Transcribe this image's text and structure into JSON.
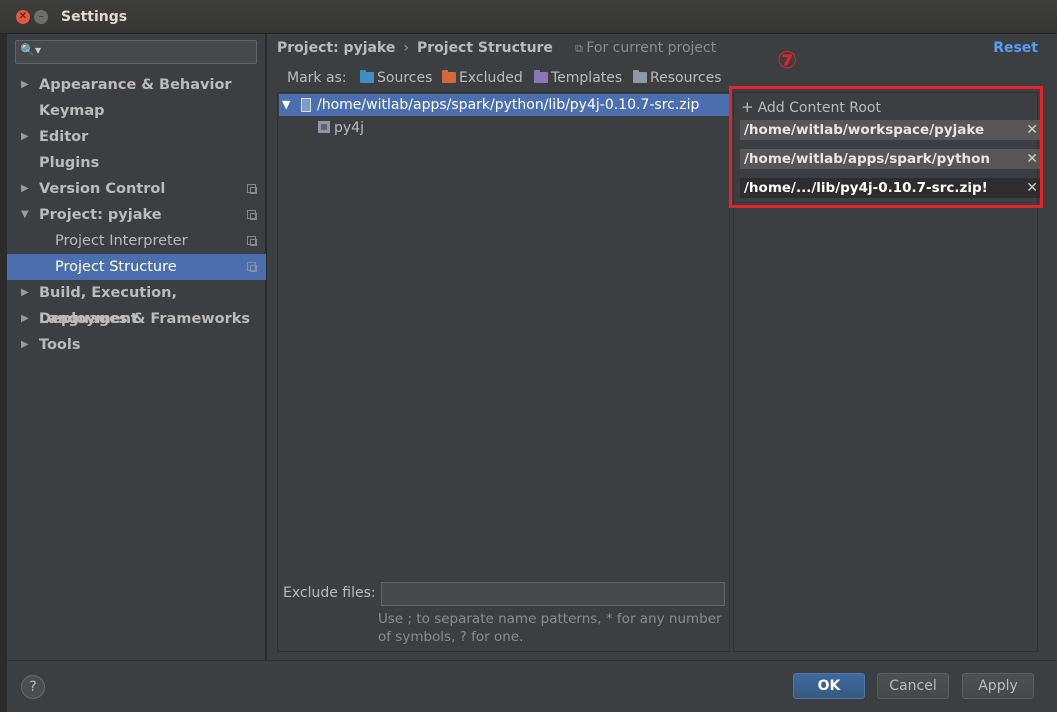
{
  "window": {
    "title": "Settings"
  },
  "sidebar": {
    "items": [
      {
        "label": "Appearance & Behavior",
        "arrow": "▶",
        "indent": "top",
        "selected": false,
        "copy": false
      },
      {
        "label": "Keymap",
        "arrow": "",
        "indent": "top",
        "selected": false,
        "copy": false
      },
      {
        "label": "Editor",
        "arrow": "▶",
        "indent": "top",
        "selected": false,
        "copy": false
      },
      {
        "label": "Plugins",
        "arrow": "",
        "indent": "top",
        "selected": false,
        "copy": false
      },
      {
        "label": "Version Control",
        "arrow": "▶",
        "indent": "top",
        "selected": false,
        "copy": true
      },
      {
        "label": "Project: pyjake",
        "arrow": "▼",
        "indent": "top",
        "selected": false,
        "copy": true
      },
      {
        "label": "Project Interpreter",
        "arrow": "",
        "indent": "sub",
        "selected": false,
        "copy": true
      },
      {
        "label": "Project Structure",
        "arrow": "",
        "indent": "sub",
        "selected": true,
        "copy": true
      },
      {
        "label": "Build, Execution, Deployment",
        "arrow": "▶",
        "indent": "top",
        "selected": false,
        "copy": false
      },
      {
        "label": "Languages & Frameworks",
        "arrow": "▶",
        "indent": "top",
        "selected": false,
        "copy": false
      },
      {
        "label": "Tools",
        "arrow": "▶",
        "indent": "top",
        "selected": false,
        "copy": false
      }
    ]
  },
  "header": {
    "crumb_project": "Project: pyjake",
    "crumb_sep": "›",
    "crumb_page": "Project Structure",
    "for_current": "For current project",
    "reset": "Reset"
  },
  "markas": {
    "label": "Mark as:",
    "sources": "Sources",
    "excluded": "Excluded",
    "templates": "Templates",
    "resources": "Resources"
  },
  "tree": {
    "selected_path": "/home/witlab/apps/spark/python/lib/py4j-0.10.7-src.zip",
    "child": "py4j"
  },
  "exclude": {
    "label": "Exclude files:",
    "hint_line1": "Use ; to separate name patterns, * for any number",
    "hint_line2": "of symbols, ? for one."
  },
  "content_roots": {
    "marker": "⑦",
    "add_label": "Add Content Root",
    "roots": [
      "/home/witlab/workspace/pyjake",
      "/home/witlab/apps/spark/python",
      "/home/.../lib/py4j-0.10.7-src.zip!"
    ],
    "remove_glyph": "✕"
  },
  "footer": {
    "help": "?",
    "ok": "OK",
    "cancel": "Cancel",
    "apply": "Apply"
  },
  "colors": {
    "selection": "#4b6eaf",
    "link": "#589df6",
    "highlight_box": "#e6222a"
  }
}
